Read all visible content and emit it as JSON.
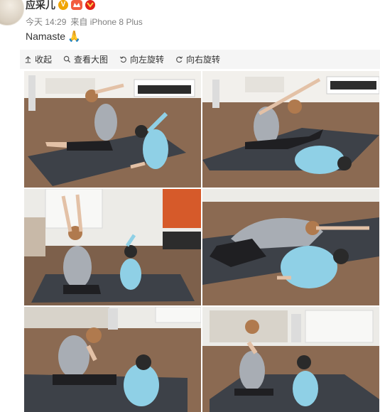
{
  "post": {
    "username": "应采儿",
    "badges": {
      "vip": "V",
      "level": "",
      "medal": ""
    },
    "meta": {
      "time": "今天 14:29",
      "source_prefix": "来自",
      "source": "iPhone 8 Plus"
    },
    "text": "Namaste",
    "text_emoji_icon": "pray-hands-icon"
  },
  "toolbar": {
    "collapse_label": "收起",
    "view_large_label": "查看大图",
    "rotate_left_label": "向左旋转",
    "rotate_right_label": "向右旋转"
  },
  "colors": {
    "toolbar_bg": "#f5f5f5",
    "floor": "#8b6a52",
    "mat": "#3d4148",
    "wall": "#f2f0ec",
    "kid_outfit": "#8fd0e6",
    "mom_top": "#a8adb4",
    "leggings": "#1f1f22"
  },
  "images": [
    {
      "id": "photo-1",
      "pose": "side-bend seated"
    },
    {
      "id": "photo-2",
      "pose": "side-bend and child pose"
    },
    {
      "id": "photo-3",
      "pose": "arms raised seated back view"
    },
    {
      "id": "photo-4",
      "pose": "forward fold child pose"
    },
    {
      "id": "photo-5",
      "pose": "prayer hands seated"
    },
    {
      "id": "photo-6",
      "pose": "prayer hands with child"
    }
  ]
}
